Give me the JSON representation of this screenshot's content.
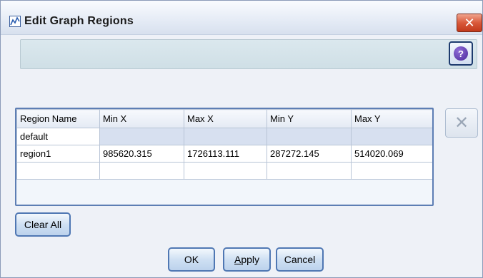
{
  "window": {
    "title": "Edit Graph Regions",
    "close_symbol": "✕",
    "help_symbol": "?"
  },
  "table": {
    "columns": [
      "Region Name",
      "Min X",
      "Max X",
      "Min Y",
      "Max Y"
    ],
    "rows": [
      [
        "default",
        "",
        "",
        "",
        ""
      ],
      [
        "region1",
        "985620.315",
        "1726113.111",
        "287272.145",
        "514020.069"
      ],
      [
        "",
        "",
        "",
        "",
        ""
      ]
    ]
  },
  "delete_symbol": "✕",
  "buttons": {
    "clear_all": "Clear All",
    "ok": "OK",
    "apply_first": "A",
    "apply_rest": "pply",
    "cancel": "Cancel"
  },
  "colors": {
    "accent": "#4f77b3",
    "close": "#c2391b"
  }
}
